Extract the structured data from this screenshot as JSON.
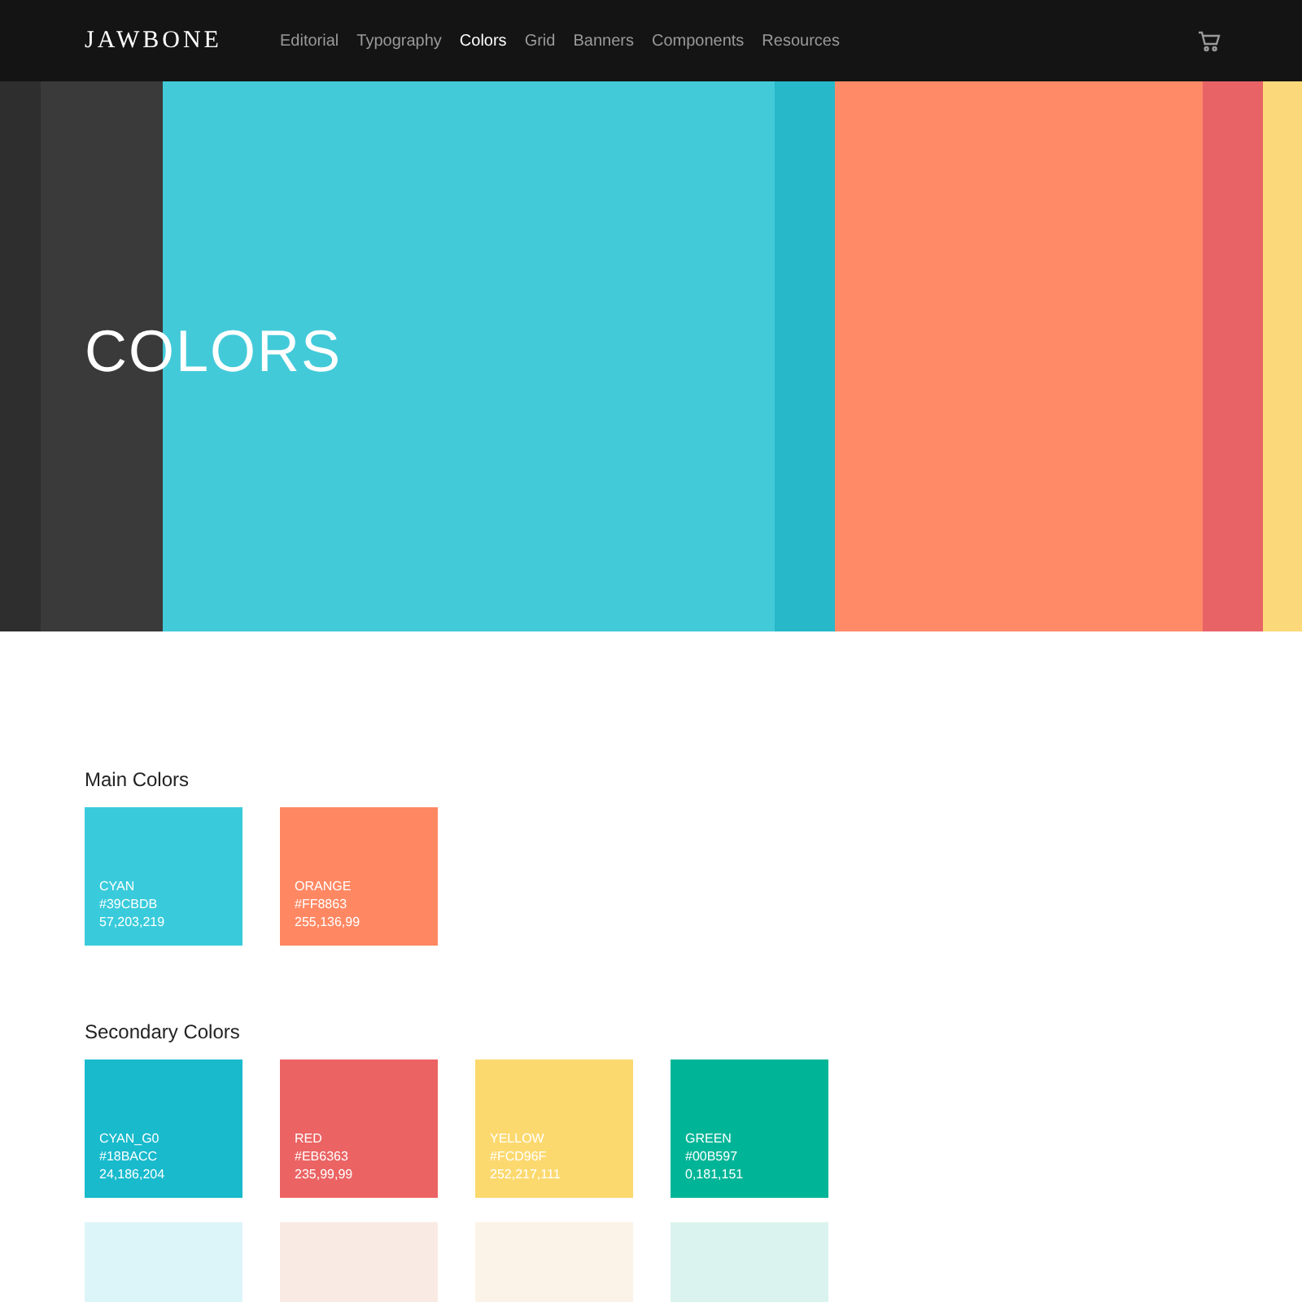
{
  "header": {
    "logo": "JAWBONE",
    "nav": [
      {
        "label": "Editorial",
        "selected": false
      },
      {
        "label": "Typography",
        "selected": false
      },
      {
        "label": "Colors",
        "selected": true
      },
      {
        "label": "Grid",
        "selected": false
      },
      {
        "label": "Banners",
        "selected": false
      },
      {
        "label": "Components",
        "selected": false
      },
      {
        "label": "Resources",
        "selected": false
      }
    ]
  },
  "hero": {
    "title": "COLORS",
    "stripes": [
      {
        "color": "#2e2e2e"
      },
      {
        "color": "#3a3a3a"
      },
      {
        "color": "#43cad9"
      },
      {
        "color": "#27b8c9"
      },
      {
        "color": "#ff8a68"
      },
      {
        "color": "#e86366"
      },
      {
        "color": "#fbd97a"
      }
    ]
  },
  "sections": [
    {
      "title": "Main Colors",
      "swatches": [
        {
          "color": "#39cbdb",
          "name": "CYAN",
          "hex": "#39CBDB",
          "rgb": "57,203,219"
        },
        {
          "color": "#ff8863",
          "name": "ORANGE",
          "hex": "#FF8863",
          "rgb": "255,136,99"
        }
      ]
    },
    {
      "title": "Secondary Colors",
      "swatches": [
        {
          "color": "#18bacc",
          "name": "CYAN_G0",
          "hex": "#18BACC",
          "rgb": "24,186,204"
        },
        {
          "color": "#eb6363",
          "name": "RED",
          "hex": "#EB6363",
          "rgb": "235,99,99"
        },
        {
          "color": "#fcd96f",
          "name": "YELLOW",
          "hex": "#FCD96F",
          "rgb": "252,217,111"
        },
        {
          "color": "#00b597",
          "name": "GREEN",
          "hex": "#00B597",
          "rgb": "0,181,151"
        },
        {
          "color": "#dcf5f8"
        },
        {
          "color": "#f9ebe3"
        },
        {
          "color": "#fbf3e7"
        },
        {
          "color": "#daf3ee"
        }
      ]
    }
  ]
}
